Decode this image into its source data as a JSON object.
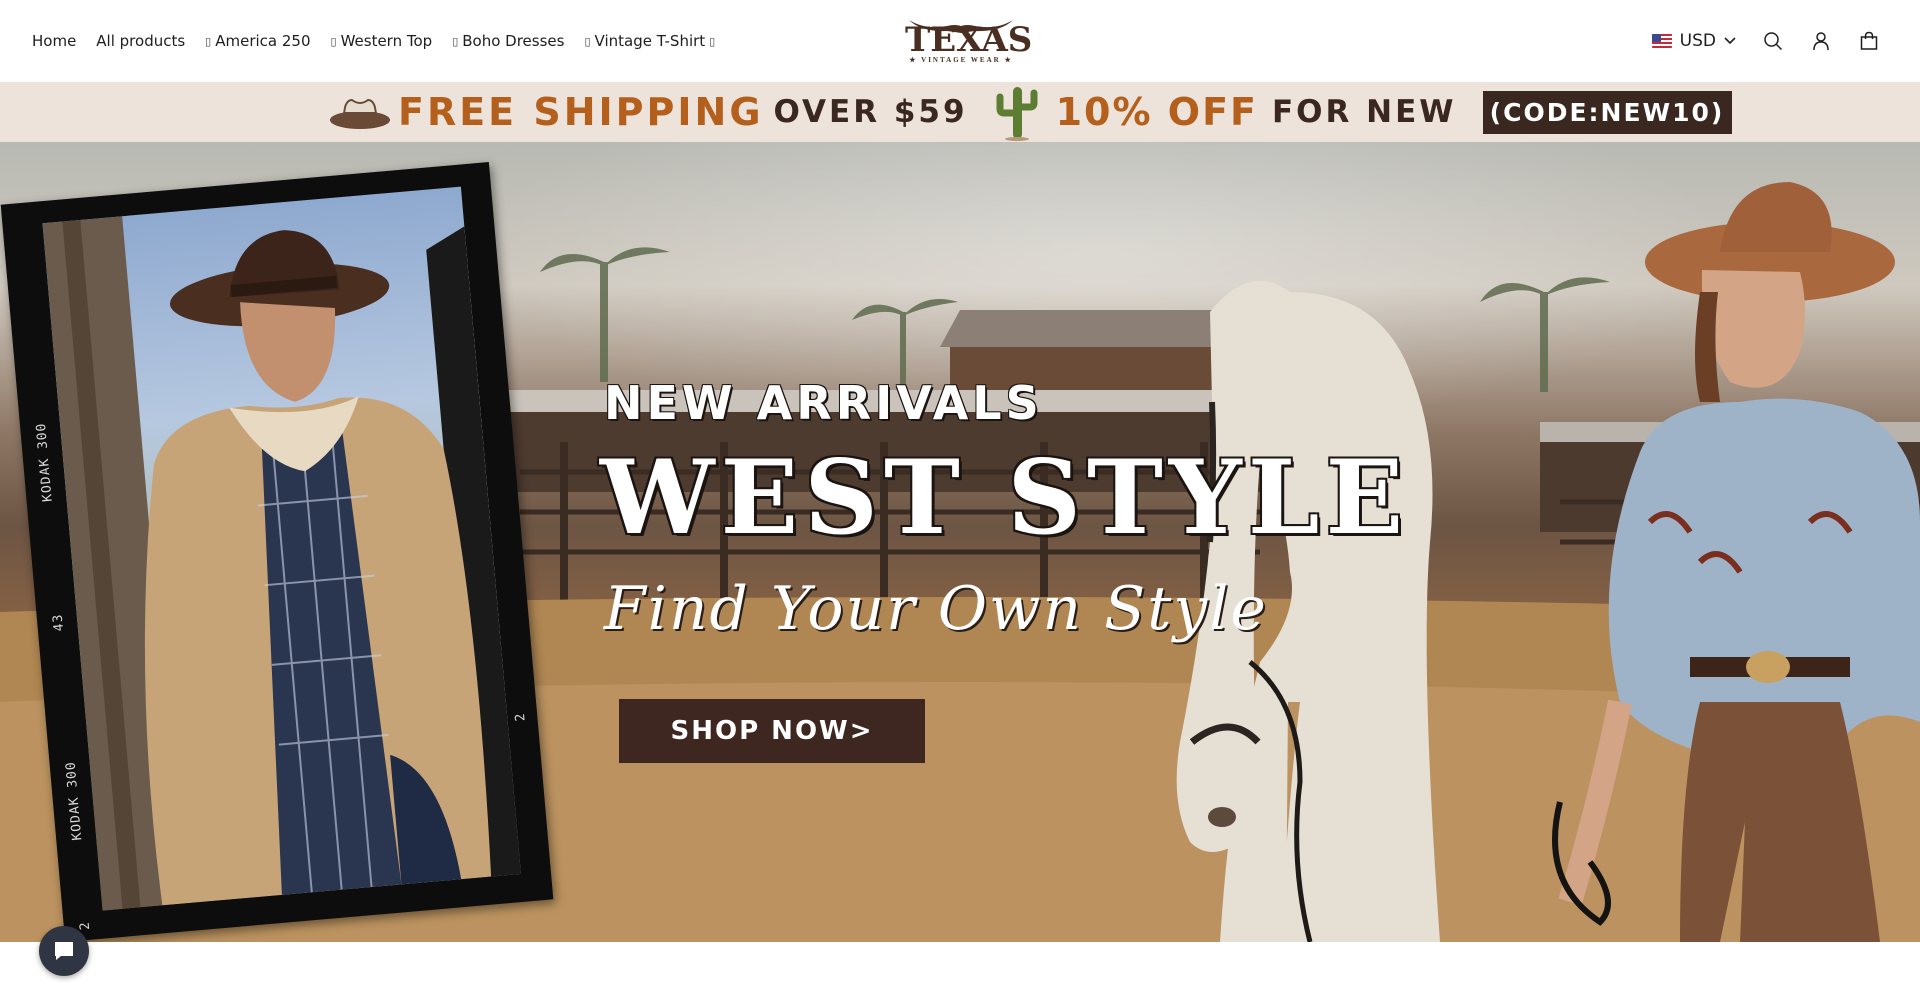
{
  "nav": {
    "items": [
      {
        "label": "Home",
        "glyph": ""
      },
      {
        "label": "All products",
        "glyph": ""
      },
      {
        "label": "America 250",
        "glyph": "▯"
      },
      {
        "label": "Western Top",
        "glyph": "▯"
      },
      {
        "label": "Boho Dresses",
        "glyph": "▯"
      },
      {
        "label": "Vintage T-Shirt",
        "glyph": "▯",
        "trailing_glyph": "▯"
      }
    ]
  },
  "logo": {
    "text": "TEXAS",
    "subtitle": "★ VINTAGE WEAR ★"
  },
  "header": {
    "currency": "USD",
    "icons": [
      "search-icon",
      "account-icon",
      "cart-icon"
    ]
  },
  "promo": {
    "free_shipping": "FREE SHIPPING",
    "over": "OVER $59",
    "discount": "10% OFF",
    "for_new": "FOR NEW",
    "code": "(CODE:NEW10)"
  },
  "hero": {
    "new_arrivals": "NEW ARRIVALS",
    "headline": "WEST STYLE",
    "tagline": "Find Your Own Style",
    "cta": "SHOP NOW>",
    "film_labels": [
      "KODAK 300",
      "43",
      "KODAK 300",
      "2",
      "2"
    ]
  },
  "colors": {
    "brand_brown": "#3d2720",
    "promo_orange": "#b4601c",
    "promo_bg": "#ede3da"
  }
}
